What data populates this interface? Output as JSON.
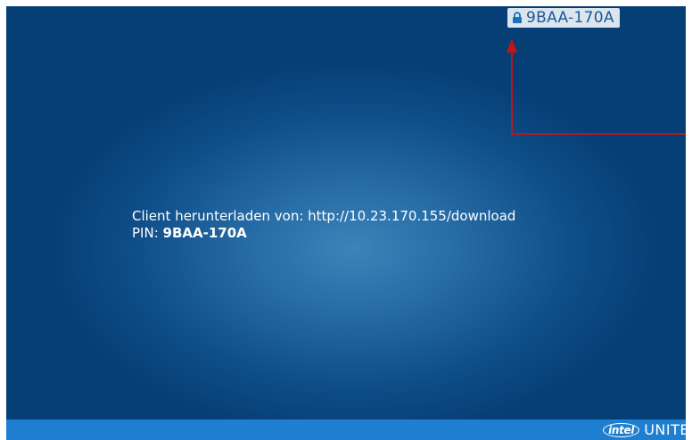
{
  "pin_badge": {
    "lock_icon": "lock-icon",
    "pin": "9BAA-170A"
  },
  "info": {
    "download_line": "Client herunterladen von: http://10.23.170.155/download",
    "pin_label": "PIN:",
    "pin_value": "9BAA-170A"
  },
  "footer": {
    "logo_text": "intel",
    "product_name": "UNITE"
  },
  "colors": {
    "background": "#0f4e89",
    "footer_bar": "#1e7fd0",
    "annotation_arrow": "#c0141a",
    "badge_background": "#dbe5ee"
  }
}
